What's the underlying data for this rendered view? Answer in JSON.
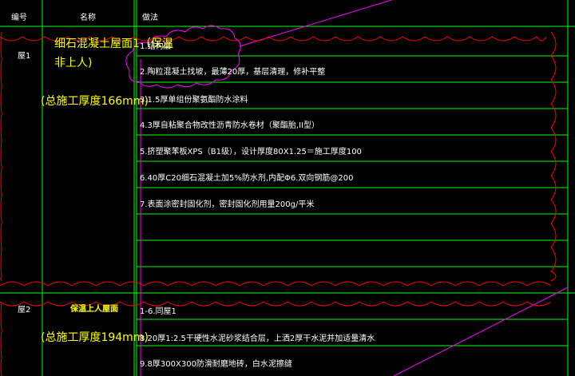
{
  "header": {
    "col_no": "编号",
    "col_name": "名称",
    "col_method": "做法"
  },
  "rows": [
    {
      "no": "屋1",
      "name_line1": "细石混凝土屋面1（保温",
      "name_line2": "非上人)",
      "total": "(总施工厚度166mm)",
      "steps": [
        "1.结构层",
        "2.陶粒混凝土找坡，最薄20厚，基层清理，修补平整",
        "3.1.5厚单组份聚氨酯防水涂料",
        "4.3厚自粘聚合物改性沥青防水卷材（聚酯胎,II型）",
        "5.挤塑聚苯板XPS（B1级），设计厚度80X1.25＝施工厚度100",
        "6.40厚C20细石混凝土加5%防水剂,内配Φ6.双向钢筋@200",
        "7.表面涂密封固化剂，密封固化剂用量200g/平米"
      ]
    },
    {
      "no": "屋2",
      "name": "保温上人屋面",
      "total": "(总施工厚度194mm)",
      "steps": [
        "1-6.同屋1",
        "8.20厚1:2.5干硬性水泥砂浆结合层，上洒2厚干水泥并加适量清水",
        "9.8厚300X300防滑耐磨地砖，白水泥擦缝"
      ]
    }
  ],
  "colors": {
    "background": "#000000",
    "grid_line": "#00ff00",
    "revision_cloud": "#ff0000",
    "magenta_cloud": "#ff00ff",
    "leader_line": "#ff00ff",
    "name_text": "#ffff00",
    "step_text": "#ffffff"
  }
}
